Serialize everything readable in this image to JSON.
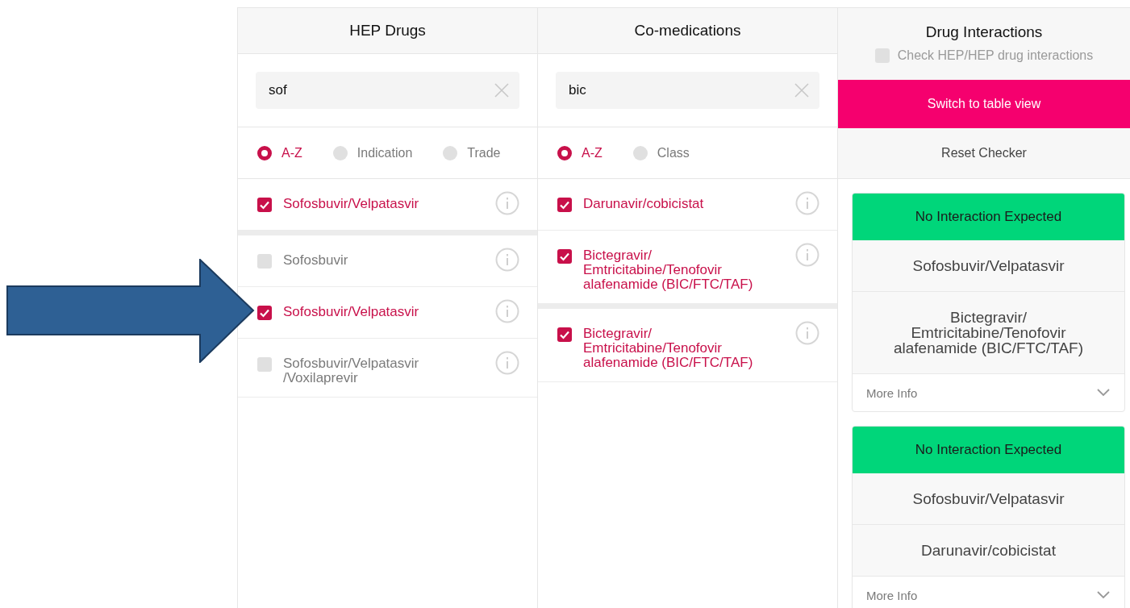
{
  "columns": [
    {
      "title": "HEP Drugs",
      "search": {
        "value": "sof"
      },
      "sort_options": [
        {
          "label": "A-Z",
          "selected": true
        },
        {
          "label": "Indication",
          "selected": false
        },
        {
          "label": "Trade",
          "selected": false
        }
      ],
      "selected_items": [
        {
          "name": "Sofosbuvir/Velpatasvir",
          "checked": true
        }
      ],
      "results": [
        {
          "name": "Sofosbuvir",
          "checked": false
        },
        {
          "name": "Sofosbuvir/Velpatasvir",
          "checked": true
        },
        {
          "name": "Sofosbuvir/Velpatasvir\n/Voxilaprevir",
          "checked": false
        }
      ]
    },
    {
      "title": "Co-medications",
      "search": {
        "value": "bic"
      },
      "sort_options": [
        {
          "label": "A-Z",
          "selected": true
        },
        {
          "label": "Class",
          "selected": false
        }
      ],
      "selected_items": [
        {
          "name": "Darunavir/cobicistat",
          "checked": true
        },
        {
          "name": "Bictegravir/\nEmtricitabine/Tenofovir\nalafenamide (BIC/FTC/TAF)",
          "checked": true
        }
      ],
      "results": [
        {
          "name": "Bictegravir/\nEmtricitabine/Tenofovir\nalafenamide (BIC/FTC/TAF)",
          "checked": true
        }
      ]
    }
  ],
  "interactions": {
    "title": "Drug Interactions",
    "hep_check": {
      "label": "Check HEP/HEP drug interactions",
      "checked": false
    },
    "buttons": [
      {
        "label": "Switch to table view",
        "kind": "primary"
      },
      {
        "label": "Reset Checker",
        "kind": "secondary"
      }
    ],
    "cards": [
      {
        "status": "No Interaction Expected",
        "color": "#00d67a",
        "drugs": [
          "Sofosbuvir/Velpatasvir",
          "Bictegravir/\nEmtricitabine/Tenofovir\nalafenamide (BIC/FTC/TAF)"
        ],
        "more": "More Info"
      },
      {
        "status": "No Interaction Expected",
        "color": "#00d67a",
        "drugs": [
          "Sofosbuvir/Velpatasvir",
          "Darunavir/cobicistat"
        ],
        "more": "More Info"
      }
    ]
  }
}
